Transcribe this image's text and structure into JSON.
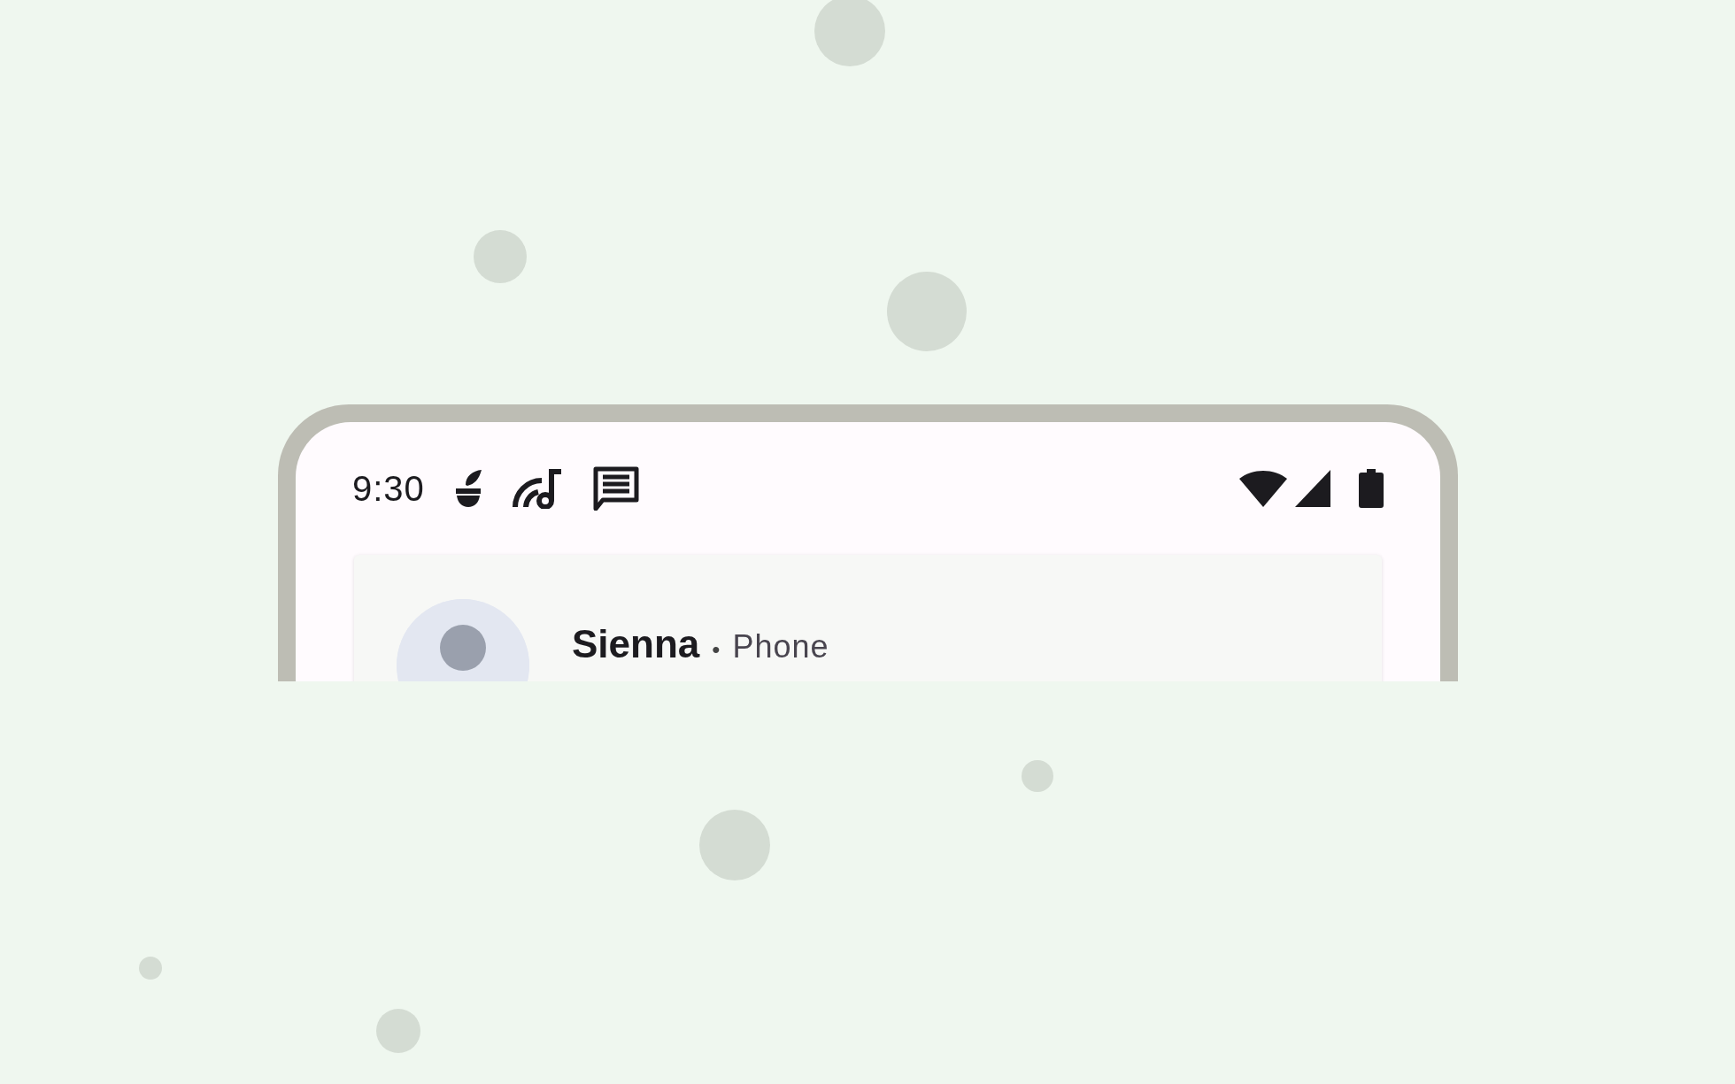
{
  "status_bar": {
    "time": "9:30"
  },
  "notification": {
    "title": "Sienna",
    "separator": "•",
    "app": "Phone"
  }
}
